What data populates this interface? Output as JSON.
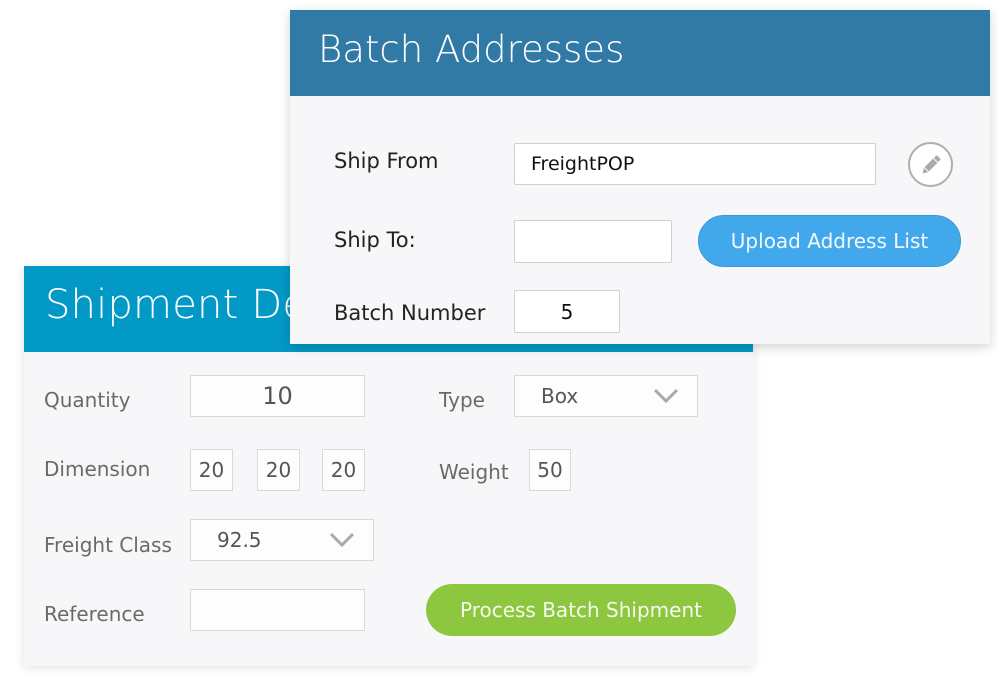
{
  "shipment_details": {
    "title": "Shipment Details",
    "fields": {
      "quantity": {
        "label": "Quantity",
        "value": "10"
      },
      "type": {
        "label": "Type",
        "value": "Box",
        "icon": "chevron-down-icon"
      },
      "dimension": {
        "label": "Dimension",
        "length": "20",
        "width": "20",
        "height": "20"
      },
      "weight": {
        "label": "Weight",
        "value": "50"
      },
      "freight_class": {
        "label": "Freight Class",
        "value": "92.5",
        "icon": "chevron-down-icon"
      },
      "reference": {
        "label": "Reference",
        "value": ""
      }
    },
    "process_button": "Process Batch Shipment"
  },
  "batch_addresses": {
    "title": "Batch Addresses",
    "ship_from": {
      "label": "Ship From",
      "value": "FreightPOP",
      "edit_icon": "pencil-icon"
    },
    "ship_to": {
      "label": "Ship To:",
      "value": ""
    },
    "upload_button": "Upload Address List",
    "batch_number": {
      "label": "Batch Number",
      "value": "5"
    }
  },
  "colors": {
    "shipment_header": "#0399c6",
    "batch_header": "#317aa6",
    "process_button": "#8dc63f",
    "upload_button": "#42a8ec",
    "card_background": "#f7f7f9"
  }
}
